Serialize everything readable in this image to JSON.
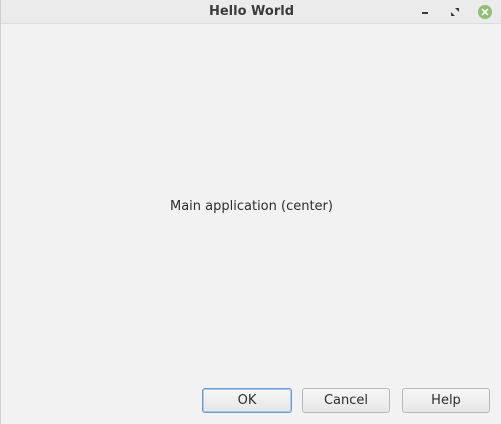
{
  "window": {
    "title": "Hello World",
    "controls": {
      "minimize": "minimize-icon",
      "maximize": "maximize-icon",
      "close": "close-icon"
    }
  },
  "main": {
    "center_text": "Main application (center)"
  },
  "buttons": {
    "ok": "OK",
    "cancel": "Cancel",
    "help": "Help"
  },
  "colors": {
    "close_button": "#8fbf72",
    "ok_focus_border": "#6b9bd1"
  }
}
